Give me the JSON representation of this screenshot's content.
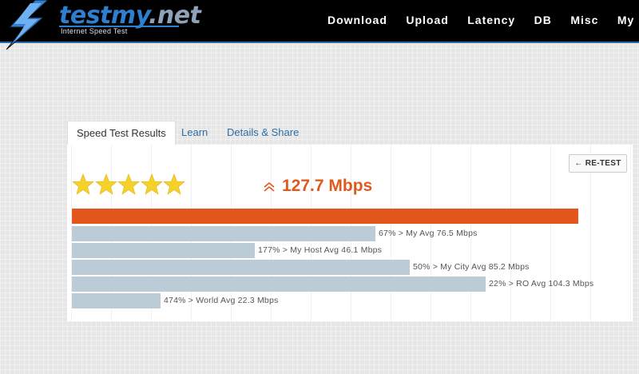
{
  "header": {
    "logo_name": "testmy",
    "logo_tld": ".net",
    "logo_tagline": "Internet Speed Test",
    "nav": [
      "Download",
      "Upload",
      "Latency",
      "DB",
      "Misc",
      "My Res"
    ]
  },
  "tabs": [
    {
      "label": "Speed Test Results",
      "active": true
    },
    {
      "label": "Learn",
      "active": false
    },
    {
      "label": "Details & Share",
      "active": false
    }
  ],
  "results": {
    "retest_label": "← RE-TEST",
    "star_rating": 5,
    "speed": "127.7 Mbps",
    "speed_mbps": 127.7,
    "comparisons": [
      {
        "label": "67% > My Avg 76.5 Mbps",
        "mbps": 76.5
      },
      {
        "label": "177% > My Host Avg 46.1 Mbps",
        "mbps": 46.1
      },
      {
        "label": "50% > My City Avg 85.2 Mbps",
        "mbps": 85.2
      },
      {
        "label": "22% > RO Avg 104.3 Mbps",
        "mbps": 104.3
      },
      {
        "label": "474% > World Avg 22.3 Mbps",
        "mbps": 22.3
      }
    ]
  },
  "colors": {
    "brand_blue": "#2f7fd0",
    "speed_orange": "#e2561b",
    "comparison_bar": "#bcccd6",
    "star_yellow": "#f5d12a"
  },
  "icons": {
    "logo": "lightning-bolt-icon",
    "speed": "double-chevron-up-icon",
    "rating": "star-icon"
  }
}
